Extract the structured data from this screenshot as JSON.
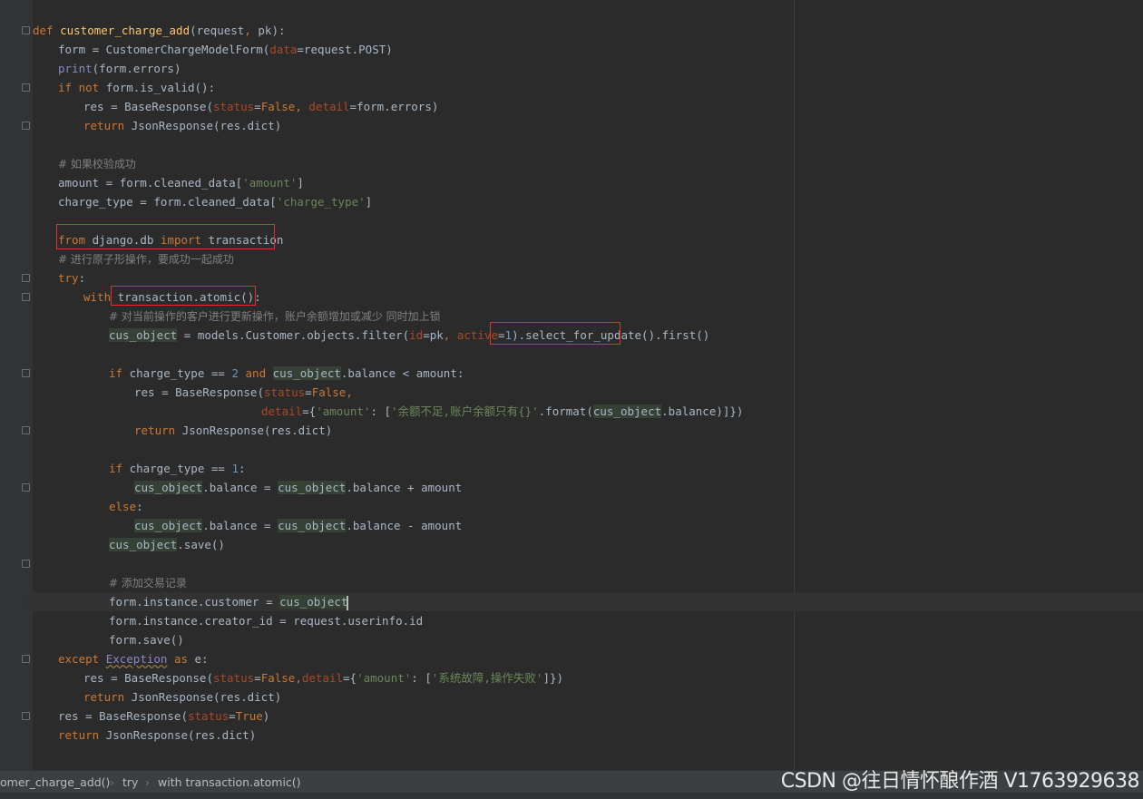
{
  "code_lines": [
    {
      "indent": 0,
      "tokens": [
        [
          "kw",
          "def "
        ],
        [
          "fn",
          "customer_charge_add"
        ],
        [
          "",
          "(request"
        ],
        [
          "kw",
          ", "
        ],
        [
          "",
          "pk):"
        ]
      ]
    },
    {
      "indent": 1,
      "tokens": [
        [
          "",
          "form = CustomerChargeModelForm("
        ],
        [
          "param",
          "data"
        ],
        [
          "",
          "=request.POST)"
        ]
      ]
    },
    {
      "indent": 1,
      "tokens": [
        [
          "builtin",
          "print"
        ],
        [
          "",
          "(form.errors)"
        ]
      ]
    },
    {
      "indent": 1,
      "tokens": [
        [
          "kw",
          "if not "
        ],
        [
          "",
          "form.is_valid():"
        ]
      ]
    },
    {
      "indent": 2,
      "tokens": [
        [
          "",
          "res = BaseResponse("
        ],
        [
          "param",
          "status"
        ],
        [
          "",
          "="
        ],
        [
          "kw",
          "False"
        ],
        [
          "kw",
          ", "
        ],
        [
          "param",
          "detail"
        ],
        [
          "",
          "=form.errors)"
        ]
      ]
    },
    {
      "indent": 2,
      "tokens": [
        [
          "kw",
          "return "
        ],
        [
          "",
          "JsonResponse(res.dict)"
        ]
      ]
    },
    {
      "indent": 0,
      "tokens": []
    },
    {
      "indent": 1,
      "tokens": [
        [
          "cmt",
          "# 如果校验成功"
        ]
      ]
    },
    {
      "indent": 1,
      "tokens": [
        [
          "",
          "amount = form.cleaned_data["
        ],
        [
          "str",
          "'amount'"
        ],
        [
          "",
          "]"
        ]
      ]
    },
    {
      "indent": 1,
      "tokens": [
        [
          "",
          "charge_type = form.cleaned_data["
        ],
        [
          "str",
          "'charge_type'"
        ],
        [
          "",
          "]"
        ]
      ]
    },
    {
      "indent": 0,
      "tokens": []
    },
    {
      "indent": 1,
      "tokens": [
        [
          "kw",
          "from "
        ],
        [
          "",
          "django.db "
        ],
        [
          "kw",
          "import "
        ],
        [
          "",
          "transaction"
        ]
      ]
    },
    {
      "indent": 1,
      "tokens": [
        [
          "cmt",
          "# 进行原子形操作，要成功一起成功"
        ]
      ]
    },
    {
      "indent": 1,
      "tokens": [
        [
          "kw",
          "try"
        ],
        [
          "",
          ":"
        ]
      ]
    },
    {
      "indent": 2,
      "tokens": [
        [
          "kw",
          "with "
        ],
        [
          "",
          "transaction.atomic():"
        ]
      ]
    },
    {
      "indent": 3,
      "tokens": [
        [
          "cmt",
          "# 对当前操作的客户进行更新操作，账户余额增加或减少 同时加上锁"
        ]
      ]
    },
    {
      "indent": 3,
      "tokens": [
        [
          "hl",
          "cus_object"
        ],
        [
          "",
          " = models.Customer.objects.filter("
        ],
        [
          "param",
          "id"
        ],
        [
          "",
          "=pk"
        ],
        [
          "kw",
          ", "
        ],
        [
          "param",
          "active"
        ],
        [
          "",
          "="
        ],
        [
          "num",
          "1"
        ],
        [
          "",
          ").select_for_update().first()"
        ]
      ]
    },
    {
      "indent": 0,
      "tokens": []
    },
    {
      "indent": 3,
      "tokens": [
        [
          "kw",
          "if "
        ],
        [
          "",
          "charge_type == "
        ],
        [
          "num",
          "2"
        ],
        [
          "kw",
          " and "
        ],
        [
          "hl",
          "cus_object"
        ],
        [
          "",
          ".balance < amount:"
        ]
      ]
    },
    {
      "indent": 4,
      "tokens": [
        [
          "",
          "res = BaseResponse("
        ],
        [
          "param",
          "status"
        ],
        [
          "",
          "="
        ],
        [
          "kw",
          "False"
        ],
        [
          "kw",
          ","
        ]
      ]
    },
    {
      "indent": 9,
      "tokens": [
        [
          "param",
          "detail"
        ],
        [
          "",
          "={"
        ],
        [
          "str",
          "'amount'"
        ],
        [
          "",
          ": ["
        ],
        [
          "str",
          "'余额不足,账户余额只有{}'"
        ],
        [
          "",
          ".format("
        ],
        [
          "hl",
          "cus_object"
        ],
        [
          "",
          ".balance)]})"
        ]
      ]
    },
    {
      "indent": 4,
      "tokens": [
        [
          "kw",
          "return "
        ],
        [
          "",
          "JsonResponse(res.dict)"
        ]
      ]
    },
    {
      "indent": 0,
      "tokens": []
    },
    {
      "indent": 3,
      "tokens": [
        [
          "kw",
          "if "
        ],
        [
          "",
          "charge_type == "
        ],
        [
          "num",
          "1"
        ],
        [
          "",
          ":"
        ]
      ]
    },
    {
      "indent": 4,
      "tokens": [
        [
          "hl",
          "cus_object"
        ],
        [
          "",
          ".balance = "
        ],
        [
          "hl",
          "cus_object"
        ],
        [
          "",
          ".balance + amount"
        ]
      ]
    },
    {
      "indent": 3,
      "tokens": [
        [
          "kw",
          "else"
        ],
        [
          "",
          ":"
        ]
      ]
    },
    {
      "indent": 4,
      "tokens": [
        [
          "hl",
          "cus_object"
        ],
        [
          "",
          ".balance = "
        ],
        [
          "hl",
          "cus_object"
        ],
        [
          "",
          ".balance - amount"
        ]
      ]
    },
    {
      "indent": 3,
      "tokens": [
        [
          "hl",
          "cus_object"
        ],
        [
          "",
          ".save()"
        ]
      ]
    },
    {
      "indent": 0,
      "tokens": []
    },
    {
      "indent": 3,
      "tokens": [
        [
          "cmt",
          "# 添加交易记录"
        ]
      ]
    },
    {
      "indent": 3,
      "current": true,
      "tokens": [
        [
          "",
          "form.instance.customer = "
        ],
        [
          "hl",
          "cus_object"
        ]
      ]
    },
    {
      "indent": 3,
      "tokens": [
        [
          "",
          "form.instance.creator_id = request.userinfo.id"
        ]
      ]
    },
    {
      "indent": 3,
      "tokens": [
        [
          "",
          "form.save()"
        ]
      ]
    },
    {
      "indent": 1,
      "tokens": [
        [
          "kw",
          "except "
        ],
        [
          "exc",
          "Exception"
        ],
        [
          "kw",
          " as "
        ],
        [
          "",
          "e:"
        ]
      ]
    },
    {
      "indent": 2,
      "tokens": [
        [
          "",
          "res = BaseResponse("
        ],
        [
          "param",
          "status"
        ],
        [
          "",
          "="
        ],
        [
          "kw",
          "False"
        ],
        [
          "kw",
          ","
        ],
        [
          "param",
          "detail"
        ],
        [
          "",
          "={"
        ],
        [
          "str",
          "'amount'"
        ],
        [
          "",
          ": ["
        ],
        [
          "str",
          "'系统故障,操作失败'"
        ],
        [
          "",
          "]})"
        ]
      ]
    },
    {
      "indent": 2,
      "tokens": [
        [
          "kw",
          "return "
        ],
        [
          "",
          "JsonResponse(res.dict)"
        ]
      ]
    },
    {
      "indent": 1,
      "tokens": [
        [
          "",
          "res = BaseResponse("
        ],
        [
          "param",
          "status"
        ],
        [
          "",
          "="
        ],
        [
          "kw",
          "True"
        ],
        [
          "",
          ")"
        ]
      ]
    },
    {
      "indent": 1,
      "tokens": [
        [
          "kw",
          "return "
        ],
        [
          "",
          "JsonResponse(res.dict)"
        ]
      ]
    }
  ],
  "breadcrumb": {
    "items": [
      "omer_charge_add()",
      "try",
      "with transaction.atomic()"
    ],
    "separator": "›"
  },
  "watermark": "CSDN @往日情怀酿作酒 V1763929638",
  "colors": {
    "editor_bg": "#2b2b2b",
    "keyword": "#cc7832",
    "function": "#ffc66d",
    "string": "#6a8759",
    "number": "#6897bb",
    "comment": "#808080",
    "param": "#aa4926",
    "highlight_box": "#e0322d"
  }
}
